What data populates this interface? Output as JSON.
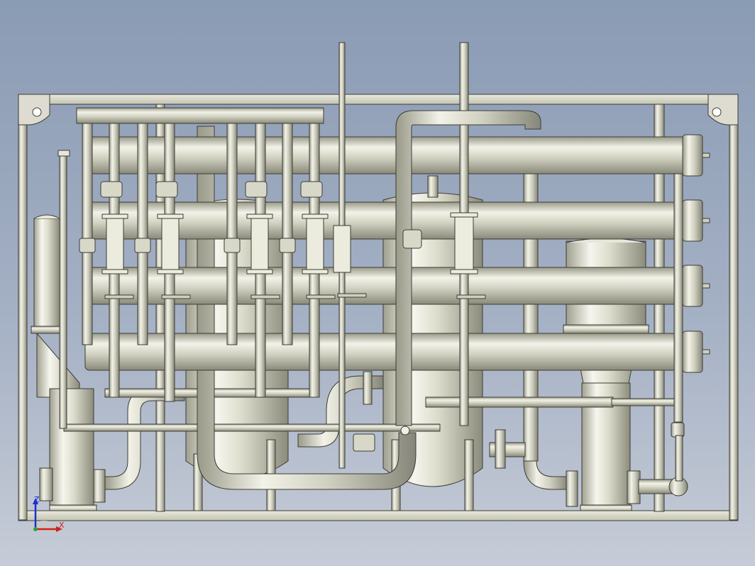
{
  "view": {
    "kind": "3D CAD model view",
    "subject": "pipe-skid",
    "background_top": "#8a9bb4",
    "background_bottom": "#c6ccd7",
    "metal_light": "#eeeee2",
    "metal_mid": "#cfcfbf",
    "metal_dark": "#8f8f80",
    "edge": "#3c3c34"
  },
  "triad": {
    "z_label": "Z",
    "x_label": "X",
    "z_color": "#1a2fd0",
    "x_color": "#d0201a"
  }
}
